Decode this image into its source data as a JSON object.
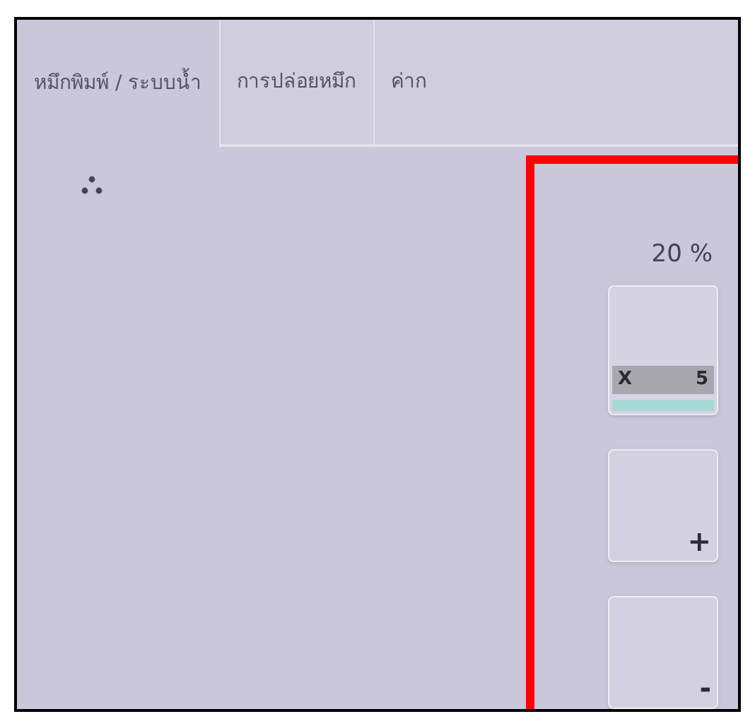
{
  "tabs": [
    {
      "label": "หมึกพิมพ์ / ระบบน้ำ",
      "selected": true
    },
    {
      "label": "การปล่อยหมึก",
      "selected": false
    },
    {
      "label": "ค่าก",
      "selected": false
    }
  ],
  "setting": {
    "reading": "20 %",
    "multiplier": "X",
    "value": "5"
  },
  "buttons": [
    {
      "label": "+"
    },
    {
      "label": "-"
    }
  ]
}
